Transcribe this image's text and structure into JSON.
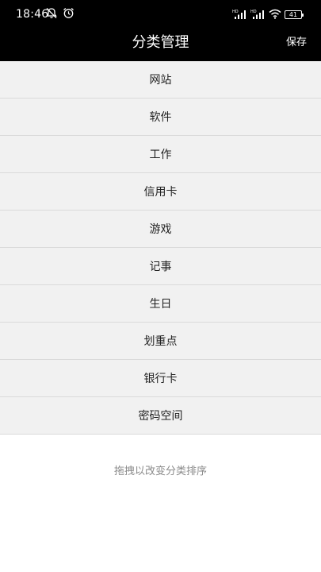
{
  "status_bar": {
    "time": "18:46",
    "battery": "41",
    "icons": [
      "notification-off-icon",
      "alarm-icon",
      "signal-hd-icon",
      "signal-hd-icon",
      "wifi-icon",
      "battery-icon"
    ]
  },
  "header": {
    "title": "分类管理",
    "save_label": "保存",
    "background": "#000000"
  },
  "categories": [
    {
      "label": "网站"
    },
    {
      "label": "软件"
    },
    {
      "label": "工作"
    },
    {
      "label": "信用卡"
    },
    {
      "label": "游戏"
    },
    {
      "label": "记事"
    },
    {
      "label": "生日"
    },
    {
      "label": "划重点"
    },
    {
      "label": "银行卡"
    },
    {
      "label": "密码空间"
    }
  ],
  "hint": "拖拽以改变分类排序"
}
